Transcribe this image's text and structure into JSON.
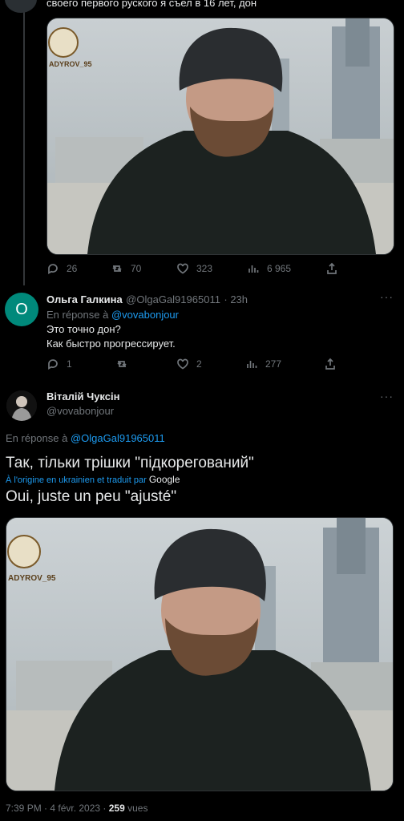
{
  "top_tweet": {
    "text": "своего первого руского я съел в 16 лет, дон",
    "watermark": "ADYROV_95",
    "stats": {
      "replies": "26",
      "retweets": "70",
      "likes": "323",
      "views": "6 965"
    }
  },
  "reply1": {
    "avatar_letter": "O",
    "avatar_color": "#00897b",
    "name": "Ольга Галкина",
    "handle": "@OlgaGal91965011",
    "time": "· 23h",
    "replying_prefix": "En réponse à",
    "replying_to": "@vovabonjour",
    "text_line1": "Это точно дон?",
    "text_line2": "Как быстро прогрессирует.",
    "stats": {
      "replies": "1",
      "likes": "2",
      "views": "277"
    }
  },
  "main_tweet": {
    "name": "Віталій Чуксін",
    "handle": "@vovabonjour",
    "replying_prefix": "En réponse à",
    "replying_to": "@OlgaGal91965011",
    "original_text": "Так, тільки трішки \"підкорегований\"",
    "translated_note": "À l'origine en ukrainien et traduit par",
    "translator": "Google",
    "translated_text": "Oui, juste un peu \"ajusté\"",
    "watermark": "ADYROV_95",
    "time": "7:39 PM · 4 févr. 2023 ·",
    "views_count": "259",
    "views_label": "vues"
  }
}
